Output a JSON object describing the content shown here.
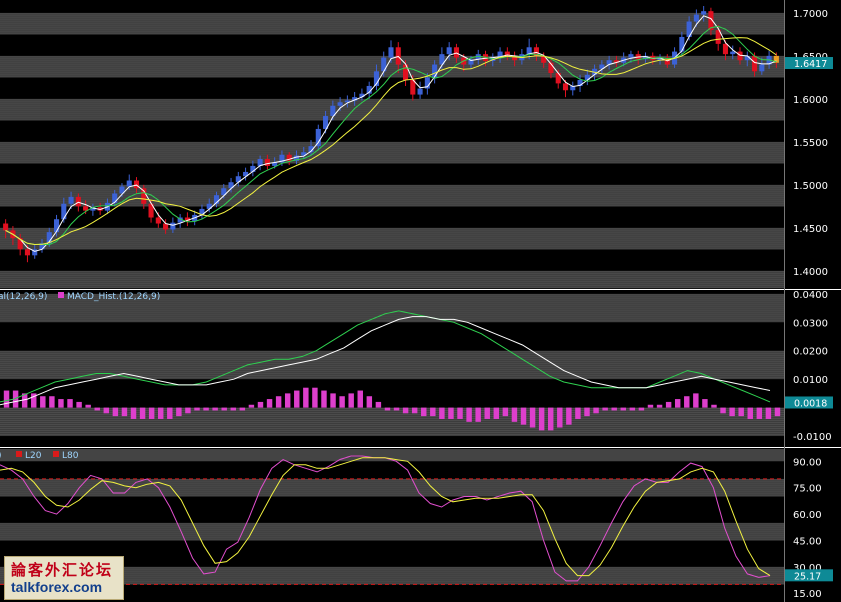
{
  "chart_data": [
    {
      "type": "candlestick",
      "panel": "price",
      "y_ticks": [
        "1.7000",
        "1.6500",
        "1.6000",
        "1.5500",
        "1.5000",
        "1.4500",
        "1.4000"
      ],
      "ylim": [
        1.38,
        1.715
      ],
      "last_price": "1.6417",
      "candles": [
        [
          1.455,
          1.447,
          1.46,
          1.438
        ],
        [
          1.447,
          1.438,
          1.452,
          1.43
        ],
        [
          1.438,
          1.425,
          1.443,
          1.418
        ],
        [
          1.425,
          1.418,
          1.43,
          1.41
        ],
        [
          1.418,
          1.425,
          1.43,
          1.414
        ],
        [
          1.425,
          1.432,
          1.437,
          1.421
        ],
        [
          1.432,
          1.445,
          1.45,
          1.428
        ],
        [
          1.445,
          1.46,
          1.465,
          1.44
        ],
        [
          1.46,
          1.478,
          1.485,
          1.456
        ],
        [
          1.478,
          1.486,
          1.492,
          1.472
        ],
        [
          1.486,
          1.475,
          1.49,
          1.469
        ],
        [
          1.475,
          1.47,
          1.482,
          1.466
        ],
        [
          1.47,
          1.474,
          1.478,
          1.464
        ],
        [
          1.474,
          1.47,
          1.479,
          1.465
        ],
        [
          1.47,
          1.479,
          1.484,
          1.466
        ],
        [
          1.479,
          1.49,
          1.494,
          1.475
        ],
        [
          1.49,
          1.498,
          1.502,
          1.486
        ],
        [
          1.498,
          1.505,
          1.512,
          1.494
        ],
        [
          1.505,
          1.496,
          1.509,
          1.49
        ],
        [
          1.496,
          1.478,
          1.5,
          1.472
        ],
        [
          1.478,
          1.462,
          1.482,
          1.456
        ],
        [
          1.462,
          1.455,
          1.468,
          1.45
        ],
        [
          1.455,
          1.448,
          1.46,
          1.443
        ],
        [
          1.448,
          1.456,
          1.462,
          1.444
        ],
        [
          1.456,
          1.462,
          1.466,
          1.45
        ],
        [
          1.462,
          1.458,
          1.468,
          1.452
        ],
        [
          1.458,
          1.465,
          1.47,
          1.453
        ],
        [
          1.465,
          1.472,
          1.477,
          1.46
        ],
        [
          1.472,
          1.478,
          1.484,
          1.468
        ],
        [
          1.478,
          1.488,
          1.492,
          1.474
        ],
        [
          1.488,
          1.496,
          1.501,
          1.484
        ],
        [
          1.496,
          1.503,
          1.508,
          1.491
        ],
        [
          1.503,
          1.51,
          1.515,
          1.498
        ],
        [
          1.51,
          1.515,
          1.52,
          1.505
        ],
        [
          1.515,
          1.522,
          1.528,
          1.51
        ],
        [
          1.522,
          1.53,
          1.534,
          1.517
        ],
        [
          1.53,
          1.522,
          1.535,
          1.518
        ],
        [
          1.522,
          1.526,
          1.532,
          1.519
        ],
        [
          1.526,
          1.535,
          1.54,
          1.522
        ],
        [
          1.535,
          1.528,
          1.538,
          1.523
        ],
        [
          1.528,
          1.534,
          1.54,
          1.524
        ],
        [
          1.534,
          1.538,
          1.544,
          1.53
        ],
        [
          1.538,
          1.545,
          1.552,
          1.534
        ],
        [
          1.545,
          1.565,
          1.57,
          1.541
        ],
        [
          1.565,
          1.58,
          1.586,
          1.56
        ],
        [
          1.58,
          1.592,
          1.598,
          1.575
        ],
        [
          1.592,
          1.596,
          1.602,
          1.586
        ],
        [
          1.596,
          1.598,
          1.604,
          1.59
        ],
        [
          1.598,
          1.602,
          1.608,
          1.592
        ],
        [
          1.602,
          1.606,
          1.612,
          1.598
        ],
        [
          1.606,
          1.615,
          1.62,
          1.6
        ],
        [
          1.615,
          1.632,
          1.64,
          1.61
        ],
        [
          1.632,
          1.648,
          1.655,
          1.626
        ],
        [
          1.648,
          1.66,
          1.668,
          1.642
        ],
        [
          1.66,
          1.64,
          1.666,
          1.63
        ],
        [
          1.64,
          1.622,
          1.645,
          1.615
        ],
        [
          1.622,
          1.605,
          1.628,
          1.598
        ],
        [
          1.605,
          1.612,
          1.62,
          1.6
        ],
        [
          1.612,
          1.625,
          1.63,
          1.605
        ],
        [
          1.625,
          1.64,
          1.645,
          1.618
        ],
        [
          1.64,
          1.652,
          1.66,
          1.635
        ],
        [
          1.652,
          1.66,
          1.666,
          1.645
        ],
        [
          1.66,
          1.648,
          1.664,
          1.642
        ],
        [
          1.648,
          1.64,
          1.652,
          1.632
        ],
        [
          1.64,
          1.646,
          1.65,
          1.635
        ],
        [
          1.646,
          1.652,
          1.657,
          1.64
        ],
        [
          1.652,
          1.644,
          1.656,
          1.638
        ],
        [
          1.644,
          1.648,
          1.653,
          1.638
        ],
        [
          1.648,
          1.655,
          1.66,
          1.642
        ],
        [
          1.655,
          1.65,
          1.66,
          1.645
        ],
        [
          1.65,
          1.645,
          1.655,
          1.638
        ],
        [
          1.645,
          1.652,
          1.658,
          1.64
        ],
        [
          1.652,
          1.66,
          1.67,
          1.646
        ],
        [
          1.66,
          1.65,
          1.664,
          1.644
        ],
        [
          1.65,
          1.642,
          1.654,
          1.636
        ],
        [
          1.642,
          1.63,
          1.646,
          1.624
        ],
        [
          1.63,
          1.618,
          1.634,
          1.612
        ],
        [
          1.618,
          1.61,
          1.622,
          1.602
        ],
        [
          1.61,
          1.615,
          1.62,
          1.604
        ],
        [
          1.615,
          1.622,
          1.628,
          1.608
        ],
        [
          1.622,
          1.628,
          1.634,
          1.616
        ],
        [
          1.628,
          1.635,
          1.64,
          1.622
        ],
        [
          1.635,
          1.64,
          1.645,
          1.63
        ],
        [
          1.64,
          1.645,
          1.65,
          1.634
        ],
        [
          1.645,
          1.642,
          1.65,
          1.637
        ],
        [
          1.642,
          1.648,
          1.654,
          1.638
        ],
        [
          1.648,
          1.652,
          1.656,
          1.642
        ],
        [
          1.652,
          1.646,
          1.656,
          1.64
        ],
        [
          1.646,
          1.65,
          1.654,
          1.642
        ],
        [
          1.65,
          1.645,
          1.654,
          1.64
        ],
        [
          1.645,
          1.648,
          1.652,
          1.64
        ],
        [
          1.648,
          1.64,
          1.652,
          1.636
        ],
        [
          1.64,
          1.655,
          1.66,
          1.636
        ],
        [
          1.655,
          1.672,
          1.678,
          1.65
        ],
        [
          1.672,
          1.69,
          1.696,
          1.668
        ],
        [
          1.69,
          1.698,
          1.704,
          1.684
        ],
        [
          1.698,
          1.702,
          1.708,
          1.69
        ],
        [
          1.702,
          1.68,
          1.706,
          1.674
        ],
        [
          1.68,
          1.664,
          1.686,
          1.656
        ],
        [
          1.664,
          1.652,
          1.668,
          1.645
        ],
        [
          1.652,
          1.655,
          1.662,
          1.646
        ],
        [
          1.655,
          1.645,
          1.66,
          1.64
        ],
        [
          1.645,
          1.65,
          1.655,
          1.638
        ],
        [
          1.65,
          1.632,
          1.654,
          1.626
        ],
        [
          1.632,
          1.64,
          1.648,
          1.628
        ],
        [
          1.64,
          1.65,
          1.656,
          1.635
        ],
        [
          1.65,
          1.642,
          1.654,
          1.636
        ]
      ]
    },
    {
      "type": "bar+line",
      "panel": "macd",
      "legend": [
        "al(12,26,9)",
        "MACD_Hist.(12,26,9)"
      ],
      "y_ticks": [
        "0.0400",
        "0.0300",
        "0.0200",
        "0.0100",
        "0.0018",
        "-0.0100"
      ],
      "ylim": [
        -0.0135,
        0.041
      ],
      "last_value": "0.0018",
      "series": [
        {
          "name": "MACD",
          "values": [
            0.002,
            0.003,
            0.005,
            0.007,
            0.009,
            0.01,
            0.011,
            0.012,
            0.012,
            0.011,
            0.01,
            0.009,
            0.008,
            0.008,
            0.008,
            0.009,
            0.011,
            0.013,
            0.015,
            0.016,
            0.017,
            0.017,
            0.018,
            0.02,
            0.023,
            0.026,
            0.029,
            0.031,
            0.033,
            0.034,
            0.033,
            0.032,
            0.031,
            0.03,
            0.028,
            0.026,
            0.023,
            0.02,
            0.017,
            0.014,
            0.011,
            0.009,
            0.008,
            0.007,
            0.007,
            0.007,
            0.007,
            0.007,
            0.009,
            0.011,
            0.013,
            0.012,
            0.01,
            0.008,
            0.006,
            0.004,
            0.002
          ]
        },
        {
          "name": "Signal",
          "values": [
            0.001,
            0.002,
            0.003,
            0.005,
            0.007,
            0.008,
            0.009,
            0.01,
            0.011,
            0.012,
            0.011,
            0.01,
            0.009,
            0.008,
            0.008,
            0.008,
            0.009,
            0.01,
            0.012,
            0.013,
            0.014,
            0.015,
            0.016,
            0.017,
            0.019,
            0.021,
            0.024,
            0.027,
            0.029,
            0.031,
            0.032,
            0.032,
            0.031,
            0.031,
            0.03,
            0.028,
            0.026,
            0.024,
            0.022,
            0.019,
            0.016,
            0.013,
            0.011,
            0.009,
            0.008,
            0.007,
            0.007,
            0.007,
            0.008,
            0.009,
            0.01,
            0.011,
            0.01,
            0.009,
            0.008,
            0.007,
            0.006
          ]
        },
        {
          "name": "MACD_Hist.(12,26,9)",
          "values": [
            0.006,
            0.006,
            0.005,
            0.005,
            0.004,
            0.004,
            0.003,
            0.003,
            0.002,
            0.001,
            -0.001,
            -0.002,
            -0.003,
            -0.003,
            -0.004,
            -0.004,
            -0.004,
            -0.004,
            -0.004,
            -0.003,
            -0.002,
            -0.001,
            -0.001,
            -0.001,
            -0.001,
            -0.001,
            -0.001,
            0.001,
            0.002,
            0.003,
            0.004,
            0.005,
            0.006,
            0.007,
            0.007,
            0.006,
            0.005,
            0.004,
            0.005,
            0.006,
            0.004,
            0.002,
            -0.001,
            -0.001,
            -0.002,
            -0.002,
            -0.003,
            -0.003,
            -0.004,
            -0.004,
            -0.004,
            -0.005,
            -0.005,
            -0.004,
            -0.004,
            -0.003,
            -0.005,
            -0.006,
            -0.007,
            -0.008,
            -0.008,
            -0.007,
            -0.006,
            -0.004,
            -0.003,
            -0.002,
            -0.001,
            -0.001,
            -0.001,
            -0.001,
            -0.001,
            0.001,
            0.001,
            0.002,
            0.003,
            0.004,
            0.005,
            0.003,
            0.001,
            -0.002,
            -0.003,
            -0.003,
            -0.004,
            -0.004,
            -0.004,
            -0.003
          ]
        }
      ]
    },
    {
      "type": "line",
      "panel": "stochastic",
      "legend": [
        "L20",
        "L80"
      ],
      "y_ticks": [
        "90.00",
        "75.00",
        "60.00",
        "45.00",
        "30.00",
        "25.17",
        "15.00"
      ],
      "ylim": [
        10,
        97
      ],
      "last_value": "25.17",
      "levels": [
        20,
        80
      ],
      "series": [
        {
          "name": "%K",
          "values": [
            88,
            85,
            80,
            70,
            62,
            60,
            66,
            75,
            82,
            80,
            72,
            72,
            78,
            80,
            75,
            64,
            50,
            35,
            26,
            27,
            40,
            44,
            58,
            74,
            86,
            91,
            88,
            86,
            84,
            87,
            91,
            93,
            93,
            92,
            92,
            90,
            85,
            72,
            66,
            64,
            68,
            70,
            70,
            68,
            70,
            72,
            73,
            67,
            45,
            27,
            22,
            22,
            30,
            42,
            55,
            67,
            76,
            80,
            78,
            78,
            84,
            89,
            87,
            75,
            52,
            36,
            26,
            24,
            25
          ]
        },
        {
          "name": "%D",
          "values": [
            85,
            86,
            84,
            78,
            70,
            65,
            64,
            68,
            74,
            79,
            78,
            76,
            75,
            77,
            78,
            76,
            68,
            55,
            42,
            32,
            33,
            38,
            47,
            59,
            71,
            82,
            88,
            88,
            86,
            86,
            88,
            90,
            92,
            92,
            92,
            91,
            90,
            84,
            76,
            70,
            67,
            68,
            69,
            69,
            69,
            70,
            71,
            71,
            62,
            46,
            32,
            25,
            25,
            31,
            41,
            53,
            64,
            73,
            78,
            79,
            80,
            84,
            86,
            84,
            73,
            56,
            40,
            29,
            25
          ]
        }
      ]
    }
  ],
  "watermark": {
    "cn": "論客外汇论坛",
    "en": "talkforex.com"
  },
  "colors": {
    "up": "#3c62d6",
    "down": "#e01020",
    "ma_fast": "#ffffff",
    "ma_mid": "#2fd050",
    "ma_slow": "#f2f240",
    "hist": "#dd3fcc",
    "signal_white": "#ffffff",
    "signal_green": "#2fd050",
    "stoch_k": "#e24fcf",
    "stoch_d": "#f2f240",
    "level_line": "#d91a1a"
  }
}
